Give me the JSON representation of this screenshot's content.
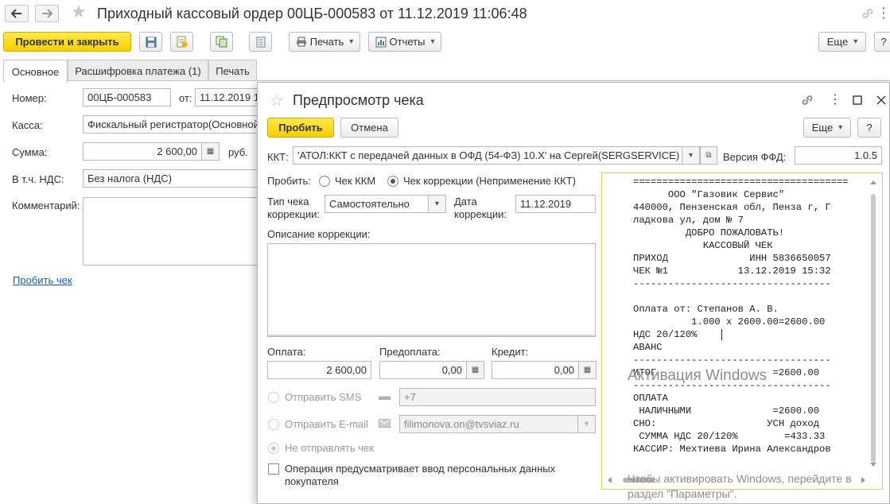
{
  "main": {
    "title": "Приходный кассовый ордер 00ЦБ-000583 от 11.12.2019 11:06:48",
    "toolbar": {
      "post_close": "Провести и закрыть",
      "print": "Печать",
      "reports": "Отчеты",
      "more": "Еще",
      "help": "?"
    },
    "tabs": [
      "Основное",
      "Расшифровка платежа (1)",
      "Печать"
    ],
    "form": {
      "number_label": "Номер:",
      "number_value": "00ЦБ-000583",
      "date_label": "от:",
      "date_value": "11.12.2019 1",
      "cash_label": "Касса:",
      "cash_value": "Фискальный регистратор(Основной",
      "sum_label": "Сумма:",
      "sum_value": "2 600,00",
      "currency": "руб.",
      "vat_label": "В т.ч. НДС:",
      "vat_value": "Без налога (НДС)",
      "comment_label": "Комментарий:",
      "print_check_link": "Пробить чек"
    }
  },
  "dialog": {
    "title": "Предпросмотр чека",
    "buttons": {
      "punch": "Пробить",
      "cancel": "Отмена",
      "more": "Еще",
      "help": "?"
    },
    "kkt_label": "ККТ:",
    "kkt_value": "'АТОЛ:ККТ с передачей данных в ОФД (54-ФЗ) 10.X' на Сергей(SERGSERVICE)",
    "ffd_label": "Версия ФФД:",
    "ffd_value": "1.0.5",
    "punch_label": "Пробить:",
    "radio_kkm": "Чек ККМ",
    "radio_correction": "Чек коррекции (Неприменение ККТ)",
    "corr_type_label_1": "Тип чека",
    "corr_type_label_2": "коррекции:",
    "corr_type_value": "Самостоятельно",
    "corr_date_label_1": "Дата",
    "corr_date_label_2": "коррекции:",
    "corr_date_value": "11.12.2019",
    "corr_desc_label": "Описание коррекции:",
    "payment_label": "Оплата:",
    "payment_value": "2 600,00",
    "prepay_label": "Предоплата:",
    "prepay_value": "0,00",
    "credit_label": "Кредит:",
    "credit_value": "0,00",
    "send_sms": "Отправить SMS",
    "sms_value": "+7",
    "send_email": "Отправить E-mail",
    "email_value": "filimonova.on@tvsviaz.ru",
    "no_send": "Не отправлять чек",
    "personal_data_1": "Операция предусматривает ввод персональных данных",
    "personal_data_2": "покупателя",
    "receipt_lines": [
      "=====================================",
      "      ООО \"Газовик Сервис\"",
      "440000, Пензенская обл, Пенза г, Г",
      "ладкова ул, дом № 7",
      "         ДОБРО ПОЖАЛОВАТЬ!",
      "            КАССОВЫЙ ЧЕК",
      "ПРИХОД              ИНН 5836650057",
      "ЧЕК №1            13.12.2019 15:32",
      "----------------------------------",
      "",
      "Оплата от: Степанов А. В.",
      "          1.000 x 2600.00=2600.00",
      "НДС 20/120%",
      "АВАНС",
      "----------------------------------",
      "ИТОГ                    =2600.00",
      "----------------------------------",
      "ОПЛАТА",
      " НАЛИЧНЫМИ              =2600.00",
      "СНО:                   УСН доход",
      " СУММА НДС 20/120%        =433.33",
      "КАССИР: Мехтиева Ирина Александров"
    ]
  },
  "watermark": {
    "line1": "Активация Windows",
    "line2": "Чтобы активировать Windows, перейдите в",
    "line3": "раздел \"Параметры\"."
  }
}
